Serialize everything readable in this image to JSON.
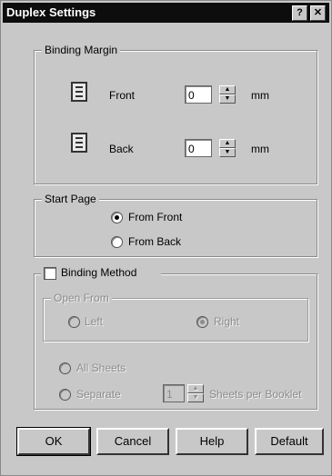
{
  "window": {
    "title": "Duplex Settings",
    "help_glyph": "?",
    "close_glyph": "✕"
  },
  "binding_margin": {
    "legend": "Binding Margin",
    "front": {
      "label": "Front",
      "value": "0",
      "unit": "mm",
      "icon": "front-page-icon"
    },
    "back": {
      "label": "Back",
      "value": "0",
      "unit": "mm",
      "icon": "back-page-icon"
    }
  },
  "start_page": {
    "legend": "Start Page",
    "options": [
      {
        "label": "From Front",
        "checked": true
      },
      {
        "label": "From Back",
        "checked": false
      }
    ]
  },
  "binding_method": {
    "label": "Binding Method",
    "checked": false,
    "open_from": {
      "legend": "Open From",
      "options": [
        {
          "label": "Left",
          "checked": false
        },
        {
          "label": "Right",
          "checked": true
        }
      ]
    },
    "sheets": {
      "all_sheets": "All Sheets",
      "separate": "Separate",
      "separate_value": "1",
      "sheets_per_booklet": "Sheets per Booklet"
    }
  },
  "buttons": {
    "ok": "OK",
    "cancel": "Cancel",
    "help": "Help",
    "default": "Default"
  }
}
